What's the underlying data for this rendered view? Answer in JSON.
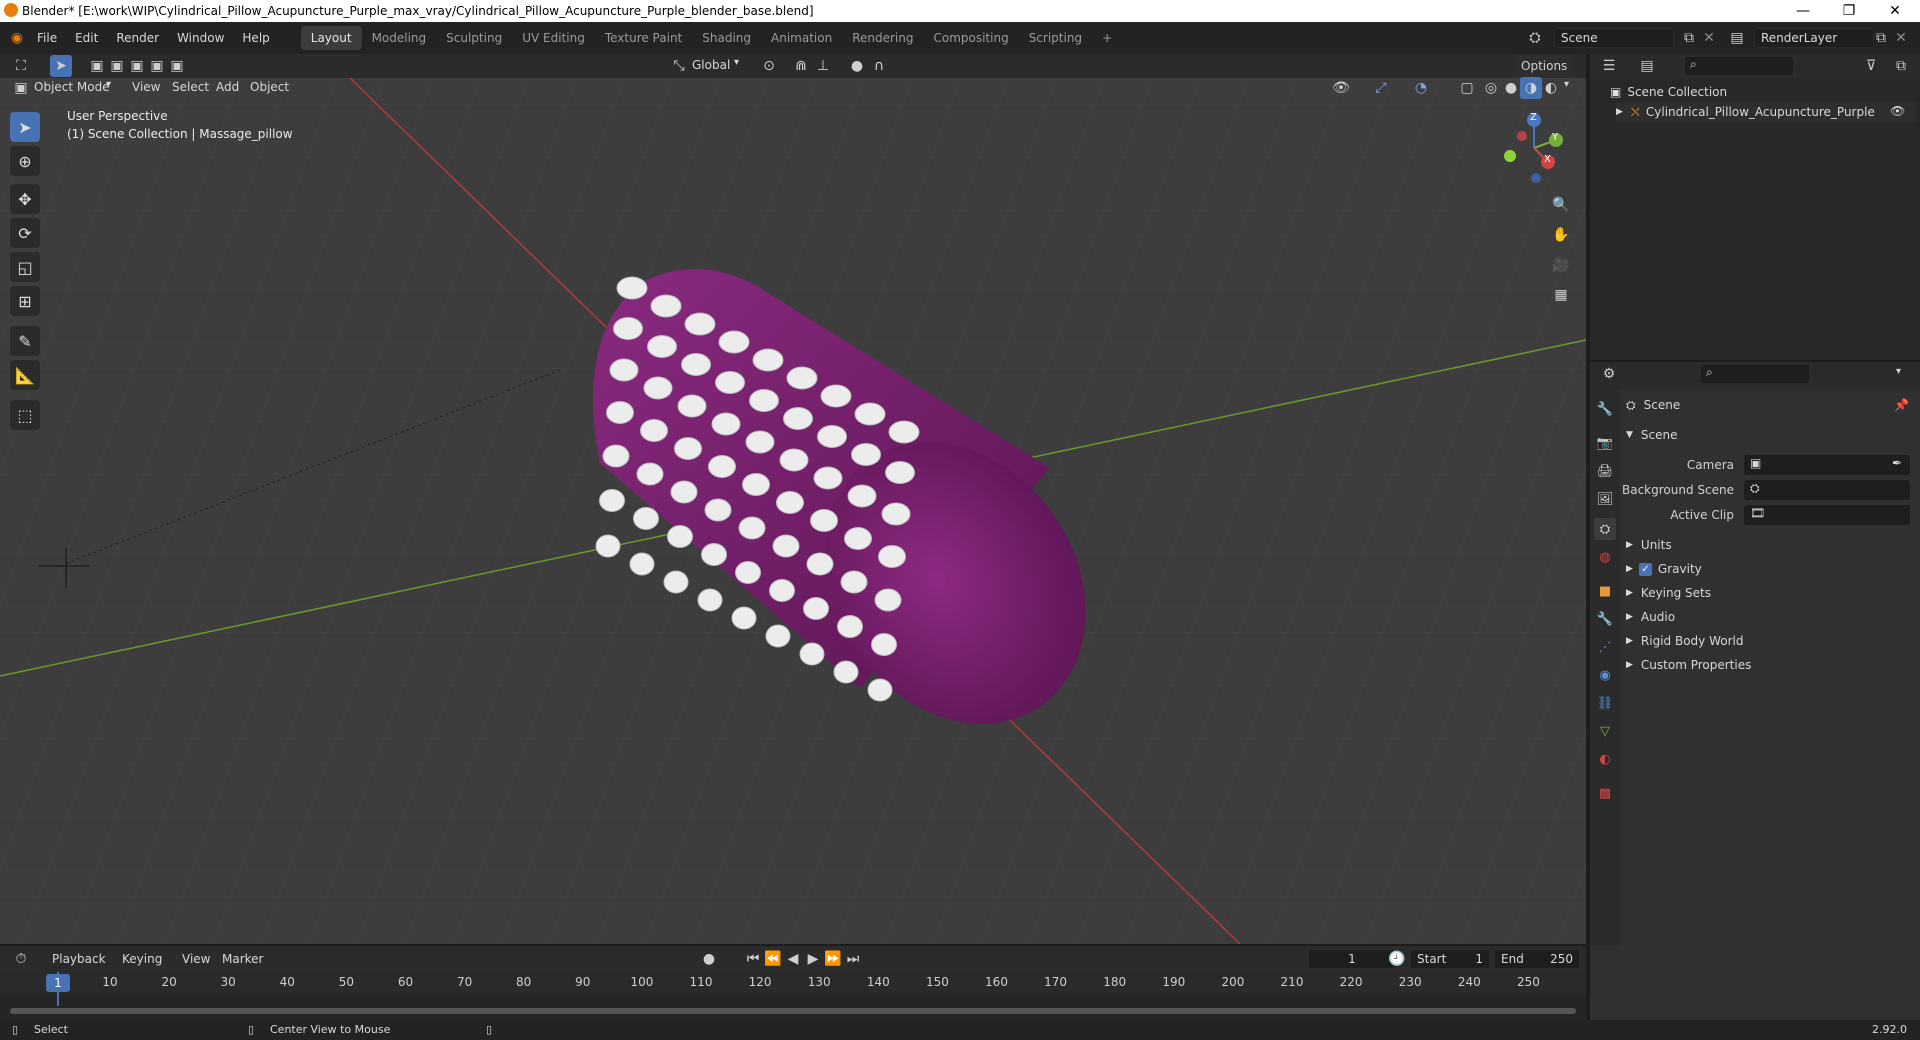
{
  "window": {
    "title": "Blender* [E:\\work\\WIP\\Cylindrical_Pillow_Acupuncture_Purple_max_vray/Cylindrical_Pillow_Acupuncture_Purple_blender_base.blend]",
    "minimize": "—",
    "restore": "❐",
    "close": "✕"
  },
  "menus": [
    "File",
    "Edit",
    "Render",
    "Window",
    "Help"
  ],
  "workspaces": [
    "Layout",
    "Modeling",
    "Sculpting",
    "UV Editing",
    "Texture Paint",
    "Shading",
    "Animation",
    "Rendering",
    "Compositing",
    "Scripting"
  ],
  "active_workspace": "Layout",
  "add_workspace": "+",
  "scene_field": "Scene",
  "renderlayer_field": "RenderLayer",
  "viewport_header": {
    "mode": "Object Mode",
    "menus": [
      "View",
      "Select",
      "Add",
      "Object"
    ],
    "transform_orientation": "Global",
    "options": "Options"
  },
  "viewport_overlay": {
    "line1": "User Perspective",
    "line2": "(1) Scene Collection | Massage_pillow"
  },
  "gizmo": {
    "x": "X",
    "y": "Y",
    "z": "Z"
  },
  "outliner": {
    "root": "Scene Collection",
    "items": [
      "Cylindrical_Pillow_Acupuncture_Purple"
    ]
  },
  "properties": {
    "header": "Scene",
    "section": "Scene",
    "fields": [
      {
        "label": "Camera",
        "value": ""
      },
      {
        "label": "Background Scene",
        "value": ""
      },
      {
        "label": "Active Clip",
        "value": ""
      }
    ],
    "panels": [
      {
        "label": "Units",
        "checkbox": false
      },
      {
        "label": "Gravity",
        "checkbox": true
      },
      {
        "label": "Keying Sets",
        "checkbox": false
      },
      {
        "label": "Audio",
        "checkbox": false
      },
      {
        "label": "Rigid Body World",
        "checkbox": false
      },
      {
        "label": "Custom Properties",
        "checkbox": false
      }
    ]
  },
  "timeline": {
    "menus": [
      "Playback",
      "Keying",
      "View",
      "Marker"
    ],
    "current_frame": "1",
    "start_label": "Start",
    "start": "1",
    "end_label": "End",
    "end": "250",
    "ruler": [
      "10",
      "20",
      "30",
      "40",
      "50",
      "60",
      "70",
      "80",
      "90",
      "100",
      "110",
      "120",
      "130",
      "140",
      "150",
      "160",
      "170",
      "180",
      "190",
      "200",
      "210",
      "220",
      "230",
      "240",
      "250"
    ],
    "playhead_label": "1"
  },
  "statusbar": {
    "left": "Select",
    "middle": "Center View to Mouse",
    "version": "2.92.0"
  },
  "colors": {
    "accent": "#4772b3",
    "pillow": "#7a2270",
    "x_axis": "#b83838",
    "y_axis": "#6b9a2a"
  }
}
